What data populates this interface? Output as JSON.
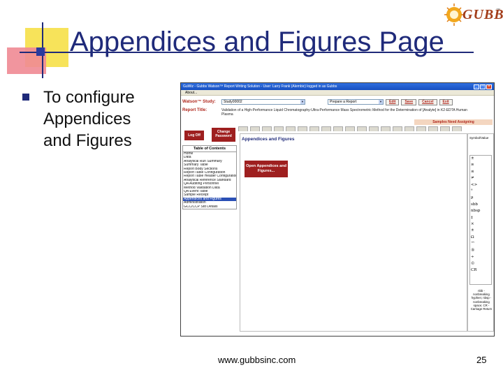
{
  "slide": {
    "title": "Appendices and Figures Page",
    "bullet": "To configure Appendices and Figures",
    "footer_url": "www.gubbsinc.com",
    "page_number": "25",
    "logo_text": "GUBBS",
    "logo_tm": "™"
  },
  "app": {
    "window_title": "GuWiz - Gubbs Watson™ Report Writing Solution - User: Larry Frank (Alembic) logged in as Gubbs",
    "menu": "About...",
    "study_label": "Watson™ Study:",
    "study_value": "Study00002",
    "report_select": "Prepare a Report",
    "edit_label": "Edit",
    "save_label": "Save",
    "cancel_label": "Cancel",
    "exit_label": "Exit",
    "report_title_label": "Report Title:",
    "report_title_value": "Validation of a High-Performance Liquid Chromatography-Ultra-Performance Mass Spectrometric Method for the Determination of [Analyte] in K2-EDTA Human Plasma",
    "samples_banner": "Samples Need Assigning",
    "logoff_label": "Log Off",
    "change_password_label": "Change Password",
    "toc_header": "Table of Contents",
    "toc_items": [
      "Home",
      "Data",
      "Analytical Run Summary",
      "Summary Table",
      "Report Body Sections",
      "Report Table Configuration",
      "Report Table Header Configuration",
      "Analytical Reference Standard",
      "QA Auditing Personnel",
      "Method Validation Data",
      "QA Event Table",
      "Sample Receipt",
      "Appendices and Figures",
      "Administration",
      "GCC/CCP Std Details"
    ],
    "selected_toc_index": 12,
    "panel_title": "Appendices and Figures",
    "open_button": "Open Appendices and Figures...",
    "right_title": "Symbol/Value",
    "symbols": [
      "±",
      "≥",
      "≤",
      "≠",
      "<>",
      "°",
      "µ",
      "sbb",
      "nbsp",
      "‡",
      "×",
      "±",
      "Ω",
      "™",
      "®",
      "÷",
      "©",
      "CR"
    ],
    "right_desc": "nbb - nonbreaking hyphen; nbsp - nonbreaking space; CR - Carriage Return"
  }
}
